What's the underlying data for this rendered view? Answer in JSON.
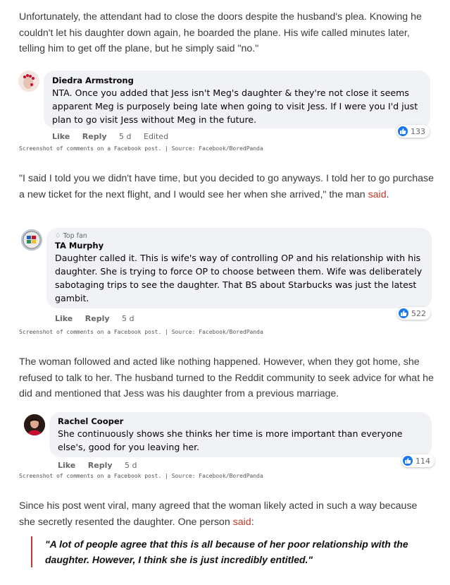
{
  "paragraphs": {
    "p1": "Unfortunately, the attendant had to close the doors despite the husband's plea. Knowing he couldn't let his daughter down again, he boarded the plane. His wife called minutes later, telling him to get off the plane, but he simply said \"no.\"",
    "p2_text": "\"I said I told you we didn't have time, but you decided to go anyways. I told her to go purchase a new ticket for the next flight, and I would see her when she arrived,\" the man",
    "p2_link": "said",
    "p2_end": ".",
    "p3": "The woman followed and acted like nothing happened. However, when they got home, she refused to talk to her. The husband turned to the Reddit community to seek advice for what he did and mentioned that Jess was his daughter from a previous marriage.",
    "p4_text": "Since his post went viral, many agreed that the woman likely acted in such a way because she secretly resented the daughter. One person",
    "p4_link": "said",
    "p4_end": ":"
  },
  "comments": [
    {
      "name": "Diedra Armstrong",
      "text": "NTA. Once you added that Jess isn't Meg's daughter & they're not close it seems apparent Meg is purposely being late when going to visit Jess. If I were you I'd just plan to go visit Jess without Meg in the future.",
      "like": "Like",
      "reply": "Reply",
      "time": "5 d",
      "edited": "Edited",
      "reactions": "133"
    },
    {
      "badge": "Top fan",
      "name": "TA Murphy",
      "text": "Daughter called it. This is wife's way of controlling OP and his relationship with his daughter. She is trying to force OP to choose between them. Wife was deliberately sabotaging trips to see the daughter. That BS about Starbucks was just the latest gambit.",
      "like": "Like",
      "reply": "Reply",
      "time": "5 d",
      "reactions": "522"
    },
    {
      "name": "Rachel Cooper",
      "text": "She continuously shows she thinks her time is more important than everyone else's, good for you leaving her.",
      "like": "Like",
      "reply": "Reply",
      "time": "5 d",
      "reactions": "114"
    }
  ],
  "caption": "Screenshot of comments on a Facebook post. | Source: Facebook/BoredPanda",
  "quote": "\"A lot of people agree that this is all because of her poor relationship with the daughter. However, I think she is just incredibly entitled.\"",
  "colors": {
    "link": "#c0392b",
    "bubble": "#f0f2f5",
    "like_blue": "#1877f2"
  }
}
